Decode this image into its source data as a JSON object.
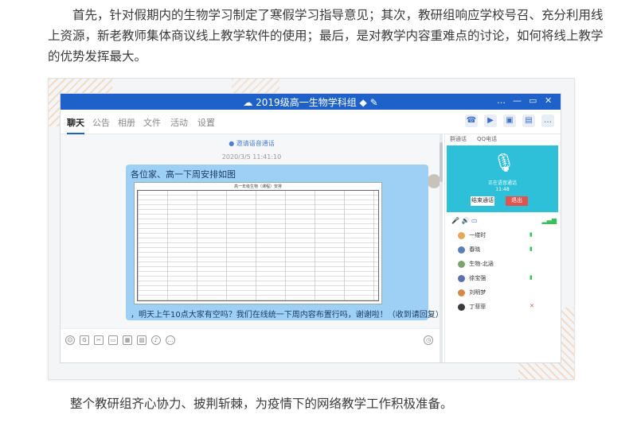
{
  "article": {
    "para1": "首先，针对假期内的生物学习制定了寒假学习指导意见；其次，教研组响应学校号召、充分利用线上资源，新老教师集体商议线上教学软件的使用；最后，是对教学内容重难点的讨论，如何将线上教学的优势发挥最大。",
    "para2": "整个教研组齐心协力、披荆斩棘，为疫情下的网络教学工作积极准备。"
  },
  "window": {
    "title": "2019级高一生物学科组",
    "title_icons": [
      "group-icon",
      "diamond-icon",
      "edit-icon"
    ],
    "controls": [
      "…",
      "—",
      "▭",
      "✕"
    ]
  },
  "tabs": [
    {
      "label": "聊天",
      "active": true
    },
    {
      "label": "公告",
      "active": false
    },
    {
      "label": "相册",
      "active": false
    },
    {
      "label": "文件",
      "active": false
    },
    {
      "label": "活动",
      "active": false
    },
    {
      "label": "设置",
      "active": false
    }
  ],
  "toolbar": [
    "phone-icon",
    "video-icon",
    "screen-share-icon",
    "presentation-icon",
    "more-icon"
  ],
  "chat": {
    "system_notice": "邀请语音通话",
    "timestamp": "2020/3/5 11:41:10",
    "message_heading": "各位家、高一下周安排如图",
    "schedule_title": "高一年级生物（课程）安排",
    "message_text": "，明天上午10点大家有空吗？我们在线统一下周内容布置行吗，谢谢啦！（收到请回复）"
  },
  "side": {
    "tabs": [
      "群通话",
      "QQ电话"
    ],
    "call_status": "正在语音通话",
    "call_time": "11:48",
    "end_label": "结束通话",
    "leave_label": "退出",
    "members": [
      {
        "name": "一缕时",
        "color": "#e7a55a"
      },
      {
        "name": "春晓",
        "color": "#5a7fb5"
      },
      {
        "name": "生物-北涵",
        "color": "#7aa36a"
      },
      {
        "name": "徐宝强",
        "color": "#5e6fb0"
      },
      {
        "name": "刘明梦",
        "color": "#d68a4a"
      },
      {
        "name": "丁菲菲",
        "color": "#3a3a3a"
      }
    ]
  }
}
